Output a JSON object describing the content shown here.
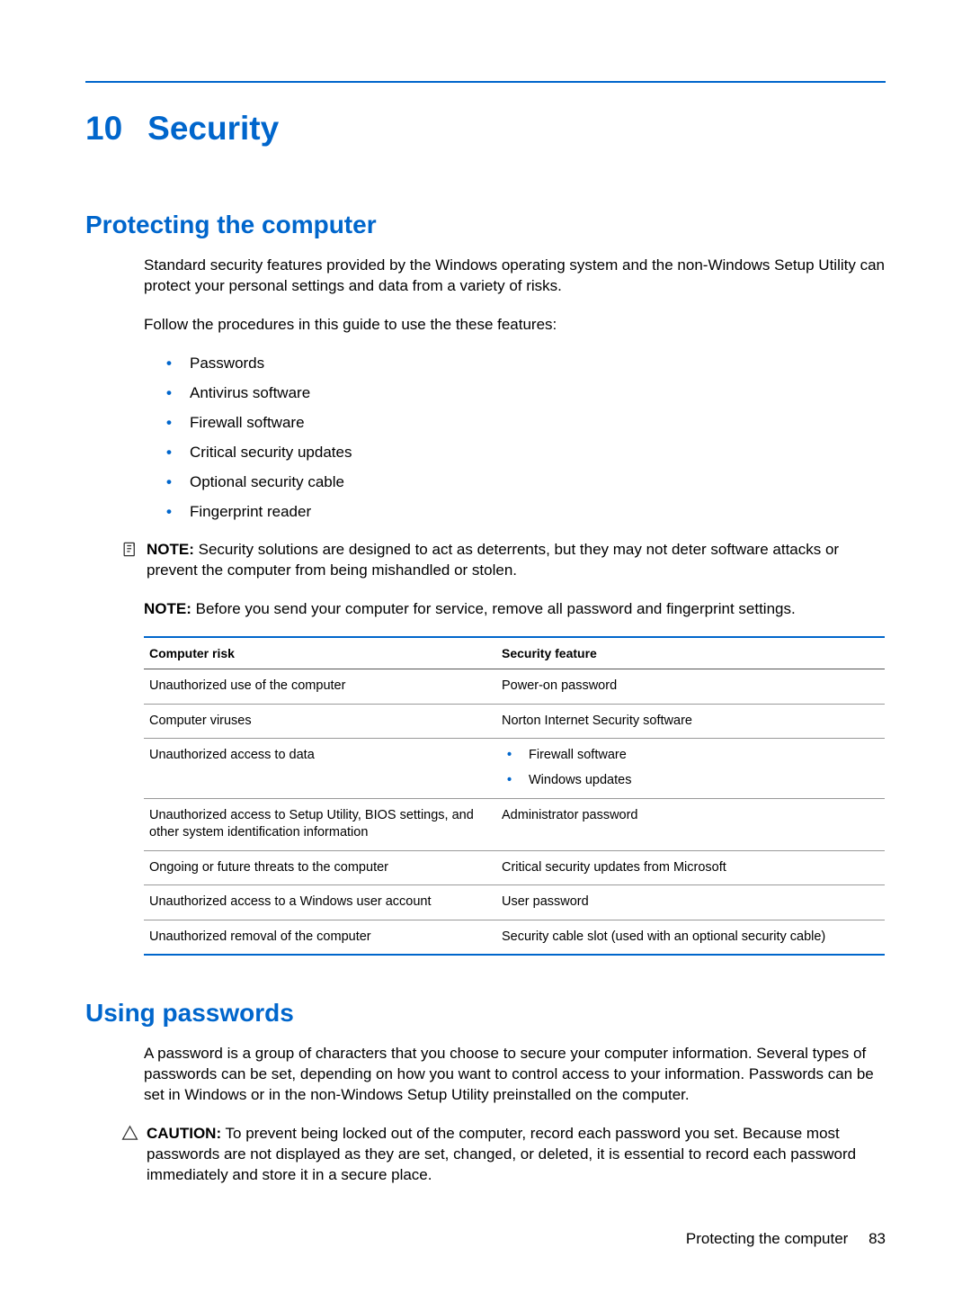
{
  "chapter": {
    "number": "10",
    "title": "Security"
  },
  "section1": {
    "title": "Protecting the computer",
    "intro": "Standard security features provided by the Windows operating system and the non-Windows Setup Utility can protect your personal settings and data from a variety of risks.",
    "follow": "Follow the procedures in this guide to use the these features:",
    "features": [
      "Passwords",
      "Antivirus software",
      "Firewall software",
      "Critical security updates",
      "Optional security cable",
      "Fingerprint reader"
    ],
    "note1_label": "NOTE:",
    "note1_text": " Security solutions are designed to act as deterrents, but they may not deter software attacks or prevent the computer from being mishandled or stolen.",
    "note2_label": "NOTE:",
    "note2_text": " Before you send your computer for service, remove all password and fingerprint settings.",
    "table": {
      "header_risk": "Computer risk",
      "header_feature": "Security feature",
      "rows": [
        {
          "risk": "Unauthorized use of the computer",
          "feature_type": "text",
          "feature": "Power-on password"
        },
        {
          "risk": "Computer viruses",
          "feature_type": "text",
          "feature": "Norton Internet Security software"
        },
        {
          "risk": "Unauthorized access to data",
          "feature_type": "list",
          "feature_items": [
            "Firewall software",
            "Windows updates"
          ]
        },
        {
          "risk": "Unauthorized access to Setup Utility, BIOS settings, and other system identification information",
          "feature_type": "text",
          "feature": "Administrator password"
        },
        {
          "risk": "Ongoing or future threats to the computer",
          "feature_type": "text",
          "feature": "Critical security updates from Microsoft"
        },
        {
          "risk": "Unauthorized access to a Windows user account",
          "feature_type": "text",
          "feature": "User password"
        },
        {
          "risk": "Unauthorized removal of the computer",
          "feature_type": "text",
          "feature": "Security cable slot (used with an optional security cable)"
        }
      ]
    }
  },
  "section2": {
    "title": "Using passwords",
    "intro": "A password is a group of characters that you choose to secure your computer information. Several types of passwords can be set, depending on how you want to control access to your information. Passwords can be set in Windows or in the non-Windows Setup Utility preinstalled on the computer.",
    "caution_label": "CAUTION:",
    "caution_text": " To prevent being locked out of the computer, record each password you set. Because most passwords are not displayed as they are set, changed, or deleted, it is essential to record each password immediately and store it in a secure place."
  },
  "footer": {
    "section": "Protecting the computer",
    "page": "83"
  }
}
